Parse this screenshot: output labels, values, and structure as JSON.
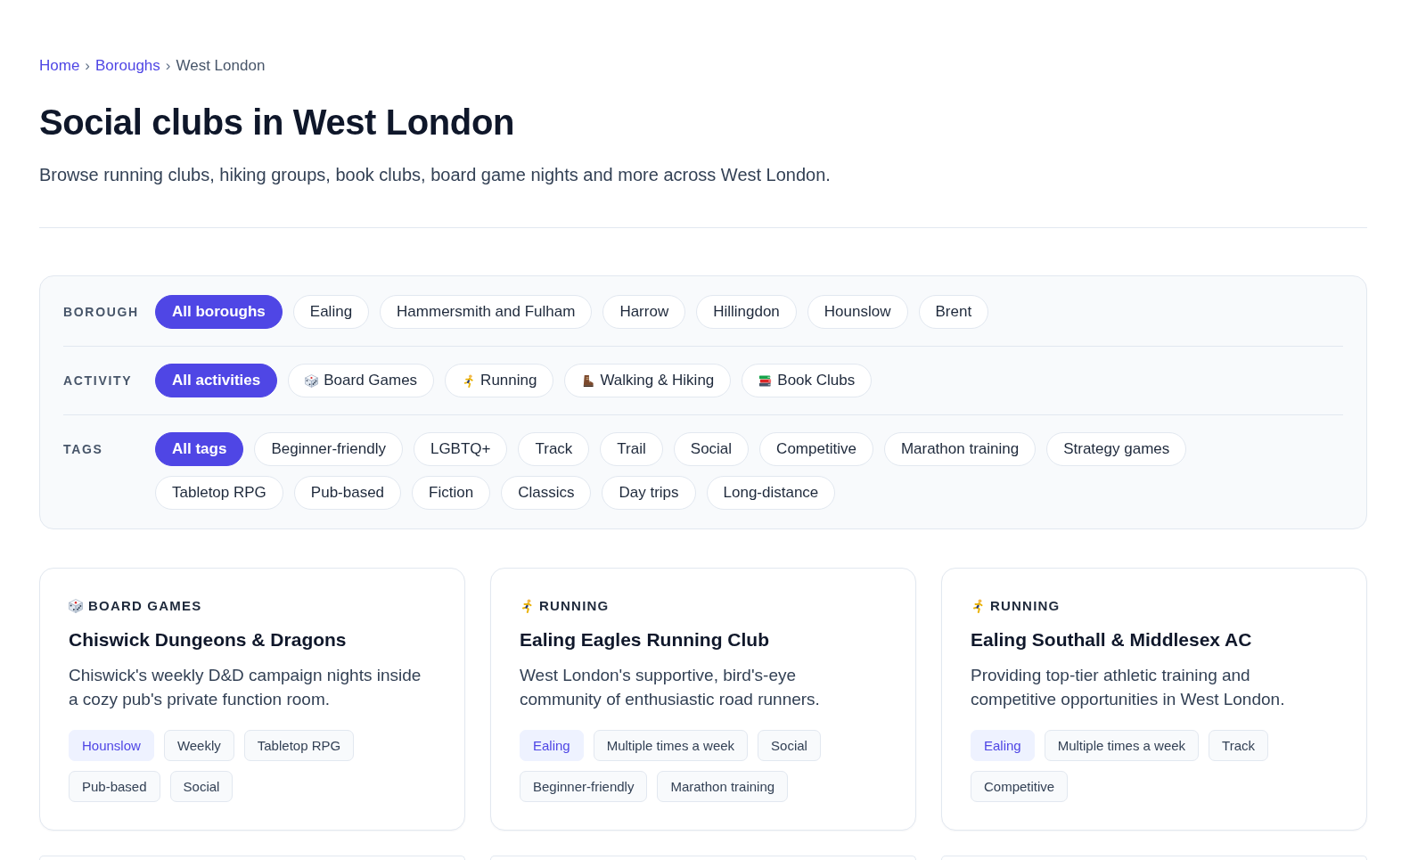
{
  "breadcrumb": [
    {
      "kind": "link",
      "text": "Home"
    },
    {
      "kind": "separator",
      "text": "›"
    },
    {
      "kind": "link",
      "text": "Boroughs"
    },
    {
      "kind": "separator",
      "text": "›"
    },
    {
      "kind": "current",
      "text": "West London"
    }
  ],
  "page": {
    "title": "Social clubs in West London",
    "subtitle": "Browse running clubs, hiking groups, book clubs, board game nights and more across West London."
  },
  "filters": [
    {
      "label": "BOROUGH",
      "options": [
        {
          "label": "All boroughs",
          "selected": true
        },
        {
          "label": "Ealing",
          "selected": false
        },
        {
          "label": "Hammersmith and Fulham",
          "selected": false
        },
        {
          "label": "Harrow",
          "selected": false
        },
        {
          "label": "Hillingdon",
          "selected": false
        },
        {
          "label": "Hounslow",
          "selected": false
        },
        {
          "label": "Brent",
          "selected": false
        }
      ]
    },
    {
      "label": "ACTIVITY",
      "options": [
        {
          "label": "All activities",
          "kind": "plain",
          "selected": true
        },
        {
          "label": "Board Games",
          "kind": "dice",
          "selected": false
        },
        {
          "label": "Running",
          "kind": "runner",
          "selected": false
        },
        {
          "label": "Walking & Hiking",
          "kind": "boot",
          "selected": false
        },
        {
          "label": "Book Clubs",
          "kind": "books",
          "selected": false
        }
      ]
    },
    {
      "label": "TAGS",
      "options": [
        {
          "label": "All tags",
          "selected": true
        },
        {
          "label": "Beginner-friendly",
          "selected": false
        },
        {
          "label": "LGBTQ+",
          "selected": false
        },
        {
          "label": "Track",
          "selected": false
        },
        {
          "label": "Trail",
          "selected": false
        },
        {
          "label": "Social",
          "selected": false
        },
        {
          "label": "Competitive",
          "selected": false
        },
        {
          "label": "Marathon training",
          "selected": false
        },
        {
          "label": "Strategy games",
          "selected": false
        },
        {
          "label": "Tabletop RPG",
          "selected": false
        },
        {
          "label": "Pub-based",
          "selected": false
        },
        {
          "label": "Fiction",
          "selected": false
        },
        {
          "label": "Classics",
          "selected": false
        },
        {
          "label": "Day trips",
          "selected": false
        },
        {
          "label": "Long-distance",
          "selected": false
        }
      ]
    }
  ],
  "clubs": [
    {
      "category": "BOARD GAMES",
      "kind": "dice",
      "name": "Chiswick Dungeons & Dragons",
      "description": "Chiswick's weekly D&D campaign nights inside a cozy pub's private function room.",
      "tags": [
        {
          "label": "Hounslow",
          "kind": "location"
        },
        {
          "label": "Weekly",
          "kind": "tag"
        },
        {
          "label": "Tabletop RPG",
          "kind": "tag"
        },
        {
          "label": "Pub-based",
          "kind": "tag"
        },
        {
          "label": "Social",
          "kind": "tag"
        }
      ]
    },
    {
      "category": "RUNNING",
      "kind": "runner",
      "name": "Ealing Eagles Running Club",
      "description": "West London's supportive, bird's-eye community of enthusiastic road runners.",
      "tags": [
        {
          "label": "Ealing",
          "kind": "location"
        },
        {
          "label": "Multiple times a week",
          "kind": "tag"
        },
        {
          "label": "Social",
          "kind": "tag"
        },
        {
          "label": "Beginner-friendly",
          "kind": "tag"
        },
        {
          "label": "Marathon training",
          "kind": "tag"
        }
      ]
    },
    {
      "category": "RUNNING",
      "kind": "runner",
      "name": "Ealing Southall & Middlesex AC",
      "description": "Providing top-tier athletic training and competitive opportunities in West London.",
      "tags": [
        {
          "label": "Ealing",
          "kind": "location"
        },
        {
          "label": "Multiple times a week",
          "kind": "tag"
        },
        {
          "label": "Track",
          "kind": "tag"
        },
        {
          "label": "Competitive",
          "kind": "tag"
        }
      ]
    }
  ]
}
